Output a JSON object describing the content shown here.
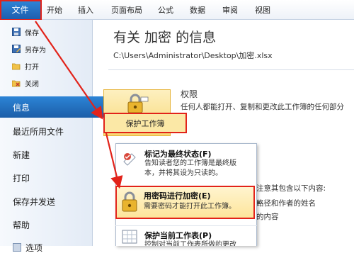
{
  "ribbon": {
    "tabs": [
      {
        "label": "文件"
      },
      {
        "label": "开始"
      },
      {
        "label": "插入"
      },
      {
        "label": "页面布局"
      },
      {
        "label": "公式"
      },
      {
        "label": "数据"
      },
      {
        "label": "审阅"
      },
      {
        "label": "视图"
      }
    ]
  },
  "sidebar": {
    "small_items": [
      {
        "label": "保存",
        "icon": "save-icon"
      },
      {
        "label": "另存为",
        "icon": "save-as-icon"
      },
      {
        "label": "打开",
        "icon": "folder-open-icon"
      },
      {
        "label": "关闭",
        "icon": "close-file-icon"
      }
    ],
    "big_items": [
      {
        "label": "信息"
      },
      {
        "label": "最近所用文件"
      },
      {
        "label": "新建"
      },
      {
        "label": "打印"
      },
      {
        "label": "保存并发送"
      },
      {
        "label": "帮助"
      },
      {
        "label": "选项"
      }
    ]
  },
  "info": {
    "heading": "有关 加密 的信息",
    "file_path": "C:\\Users\\Administrator\\Desktop\\加密.xlsx",
    "permissions_title": "权限",
    "permissions_desc": "任何人都能打开、复制和更改此工作簿的任何部分",
    "protect_button_label": "保护工作簿",
    "right_fragments": [
      "注意其包含以下内容:",
      "路径和作者的姓名",
      "的内容"
    ]
  },
  "protect_menu": {
    "items": [
      {
        "title": "标记为最终状态(F)",
        "desc1": "告知读者您的工作簿是最终版",
        "desc2": "本，并将其设为只读的。",
        "icon": "mark-final-icon"
      },
      {
        "title": "用密码进行加密(E)",
        "desc1": "需要密码才能打开此工作簿。",
        "desc2": "",
        "icon": "encrypt-lock-icon"
      },
      {
        "title": "保护当前工作表(P)",
        "desc1": "控制对当前工作表所做的更改",
        "desc2": "",
        "icon": "protect-sheet-icon"
      }
    ]
  },
  "colors": {
    "file_tab": "#1f5fae",
    "selected_nav": "#1c5ea8",
    "highlight_border": "#e2231a",
    "button_fill": "#f8d774"
  }
}
